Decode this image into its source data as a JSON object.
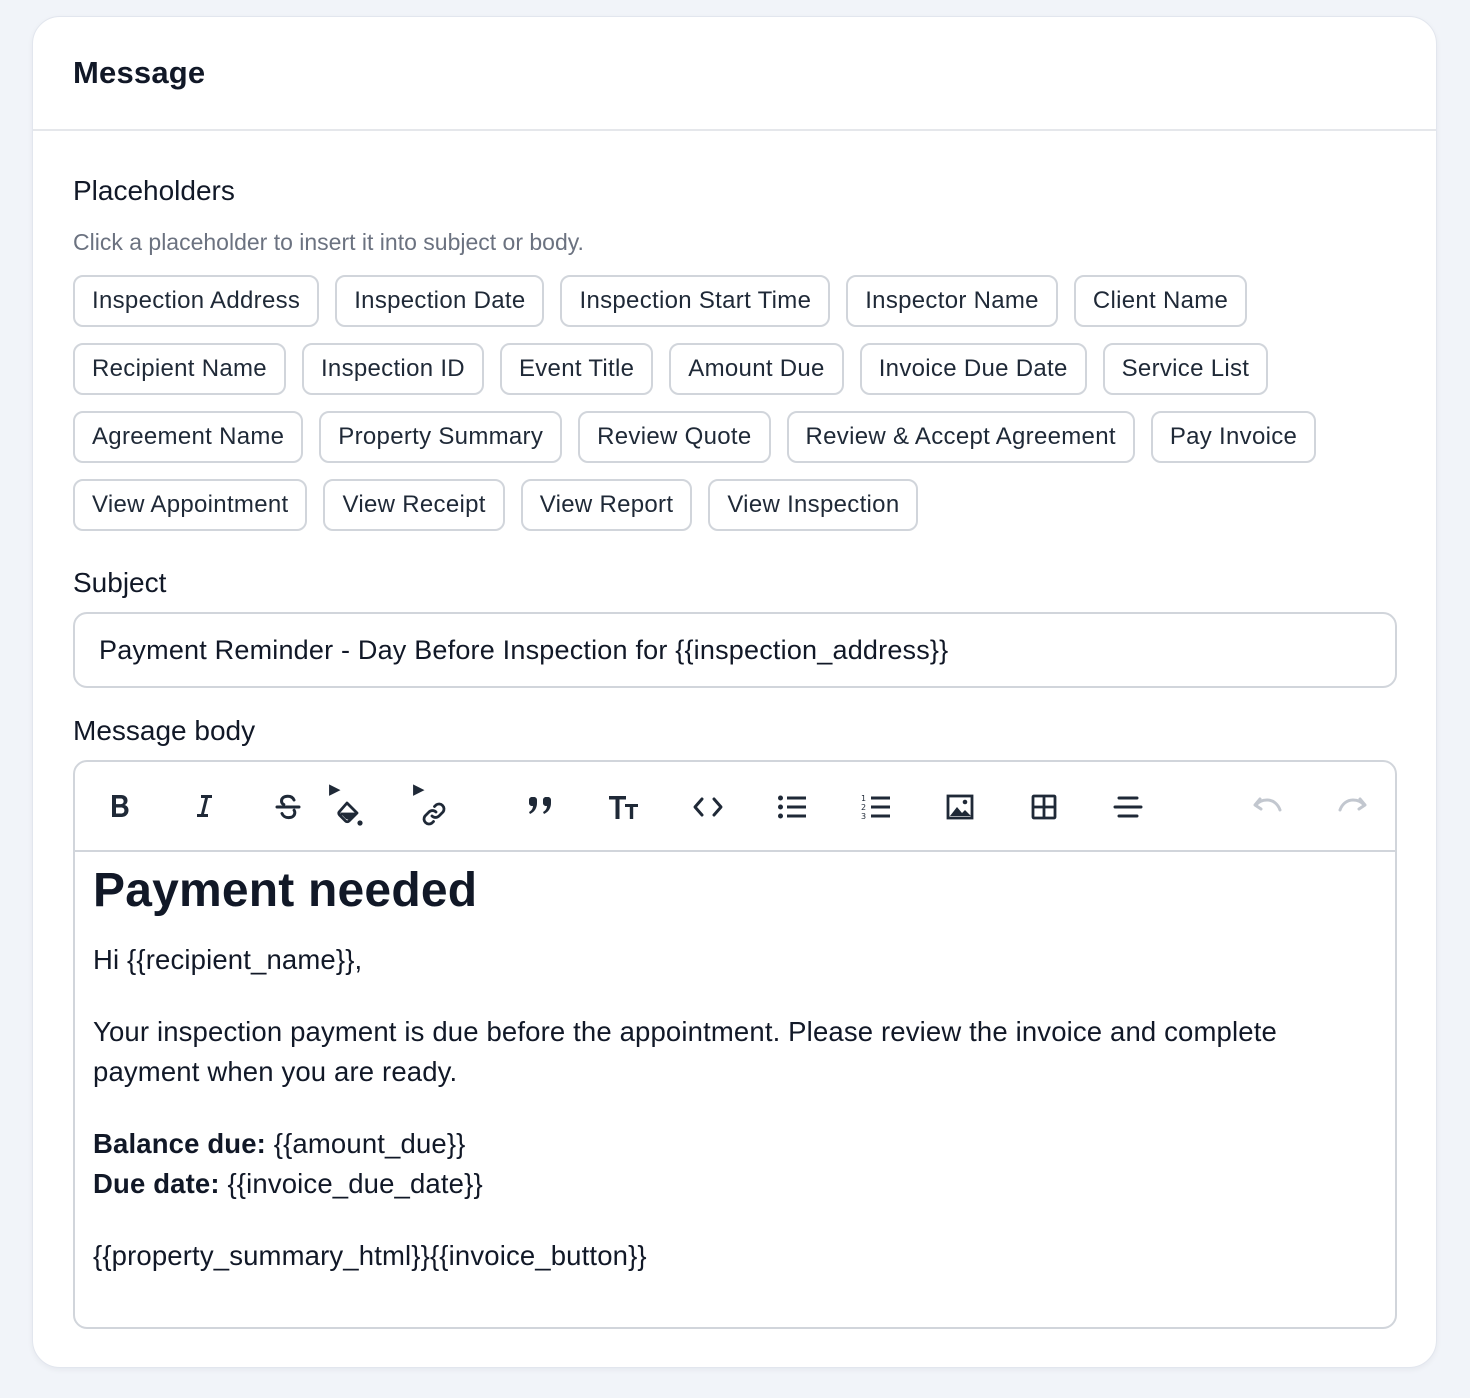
{
  "card": {
    "title": "Message"
  },
  "placeholders": {
    "label": "Placeholders",
    "hint": "Click a placeholder to insert it into subject or body.",
    "rows": [
      [
        "Inspection Address",
        "Inspection Date",
        "Inspection Start Time",
        "Inspector Name",
        "Client Name"
      ],
      [
        "Recipient Name",
        "Inspection ID",
        "Event Title",
        "Amount Due",
        "Invoice Due Date",
        "Service List"
      ],
      [
        "Agreement Name",
        "Property Summary",
        "Review Quote",
        "Review & Accept Agreement",
        "Pay Invoice"
      ],
      [
        "View Appointment",
        "View Receipt",
        "View Report",
        "View Inspection"
      ]
    ]
  },
  "subject": {
    "label": "Subject",
    "value": "Payment Reminder - Day Before Inspection for {{inspection_address}}"
  },
  "body": {
    "label": "Message body",
    "toolbar": [
      "bold-icon",
      "italic-icon",
      "strikethrough-icon",
      "highlight-color-icon",
      "link-icon",
      "blockquote-icon",
      "text-size-icon",
      "code-icon",
      "bullet-list-icon",
      "ordered-list-icon",
      "image-icon",
      "table-icon",
      "horizontal-rule-icon",
      "undo-icon",
      "redo-icon"
    ],
    "content": {
      "heading": "Payment needed",
      "greeting": "Hi {{recipient_name}},",
      "paragraph": "Your inspection payment is due before the appointment. Please review the invoice and complete payment when you are ready.",
      "balance_label": "Balance due:",
      "balance_value": " {{amount_due}}",
      "due_label": "Due date:",
      "due_value": " {{invoice_due_date}}",
      "footer": "{{property_summary_html}}{{invoice_button}}"
    }
  }
}
